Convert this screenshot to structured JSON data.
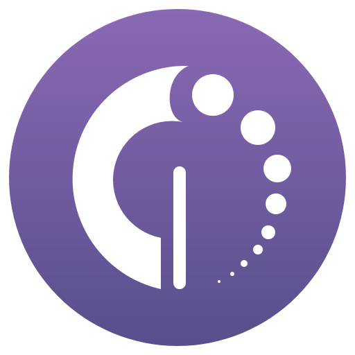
{
  "icon": {
    "name": "app-logo-icon",
    "colors": {
      "gradient_top": "#8a69b4",
      "gradient_bottom": "#584f8c",
      "mark": "#ffffff"
    }
  }
}
